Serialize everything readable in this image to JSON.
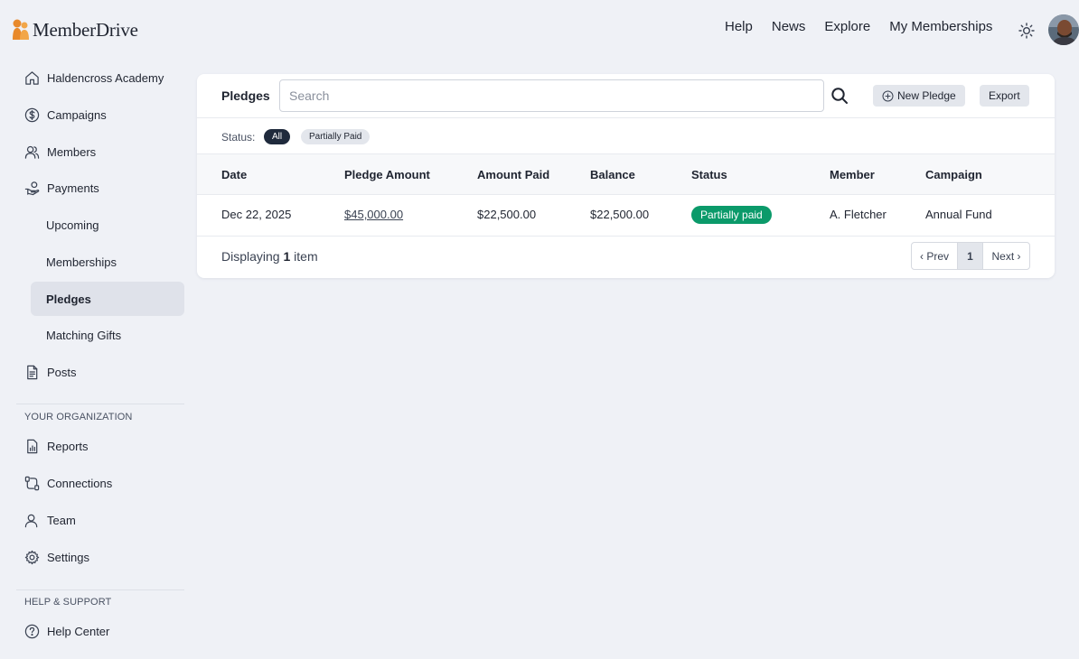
{
  "brand": {
    "name": "MemberDrive"
  },
  "topnav": [
    "Help",
    "News",
    "Explore",
    "My Memberships"
  ],
  "sidebar": {
    "org_name": "Haldencross Academy",
    "items": {
      "campaigns": "Campaigns",
      "members": "Members",
      "payments": "Payments",
      "upcoming": "Upcoming",
      "memberships": "Memberships",
      "pledges": "Pledges",
      "matching_gifts": "Matching Gifts",
      "posts": "Posts",
      "reports": "Reports",
      "connections": "Connections",
      "team": "Team",
      "settings": "Settings",
      "help_center": "Help Center"
    },
    "section_org": "YOUR ORGANIZATION",
    "section_help": "HELP & SUPPORT"
  },
  "main": {
    "title": "Pledges",
    "search_placeholder": "Search",
    "new_pledge_label": "New Pledge",
    "export_label": "Export",
    "filter_label": "Status:",
    "filters": [
      "All",
      "Partially Paid"
    ],
    "columns": [
      "Date",
      "Pledge Amount",
      "Amount Paid",
      "Balance",
      "Status",
      "Member",
      "Campaign"
    ],
    "rows": [
      {
        "date": "Dec 22, 2025",
        "pledge_amount": "$45,000.00",
        "amount_paid": "$22,500.00",
        "balance": "$22,500.00",
        "status": "Partially paid",
        "member": "A. Fletcher",
        "campaign": "Annual Fund"
      }
    ],
    "footer_prefix": "Displaying",
    "footer_count": "1",
    "footer_suffix": "item",
    "pager": {
      "prev": "‹ Prev",
      "page": "1",
      "next": "Next ›"
    }
  },
  "colors": {
    "accent": "#0b9a6a",
    "brand_orange": "#e8892b",
    "active_bg": "#dfe2ea"
  }
}
